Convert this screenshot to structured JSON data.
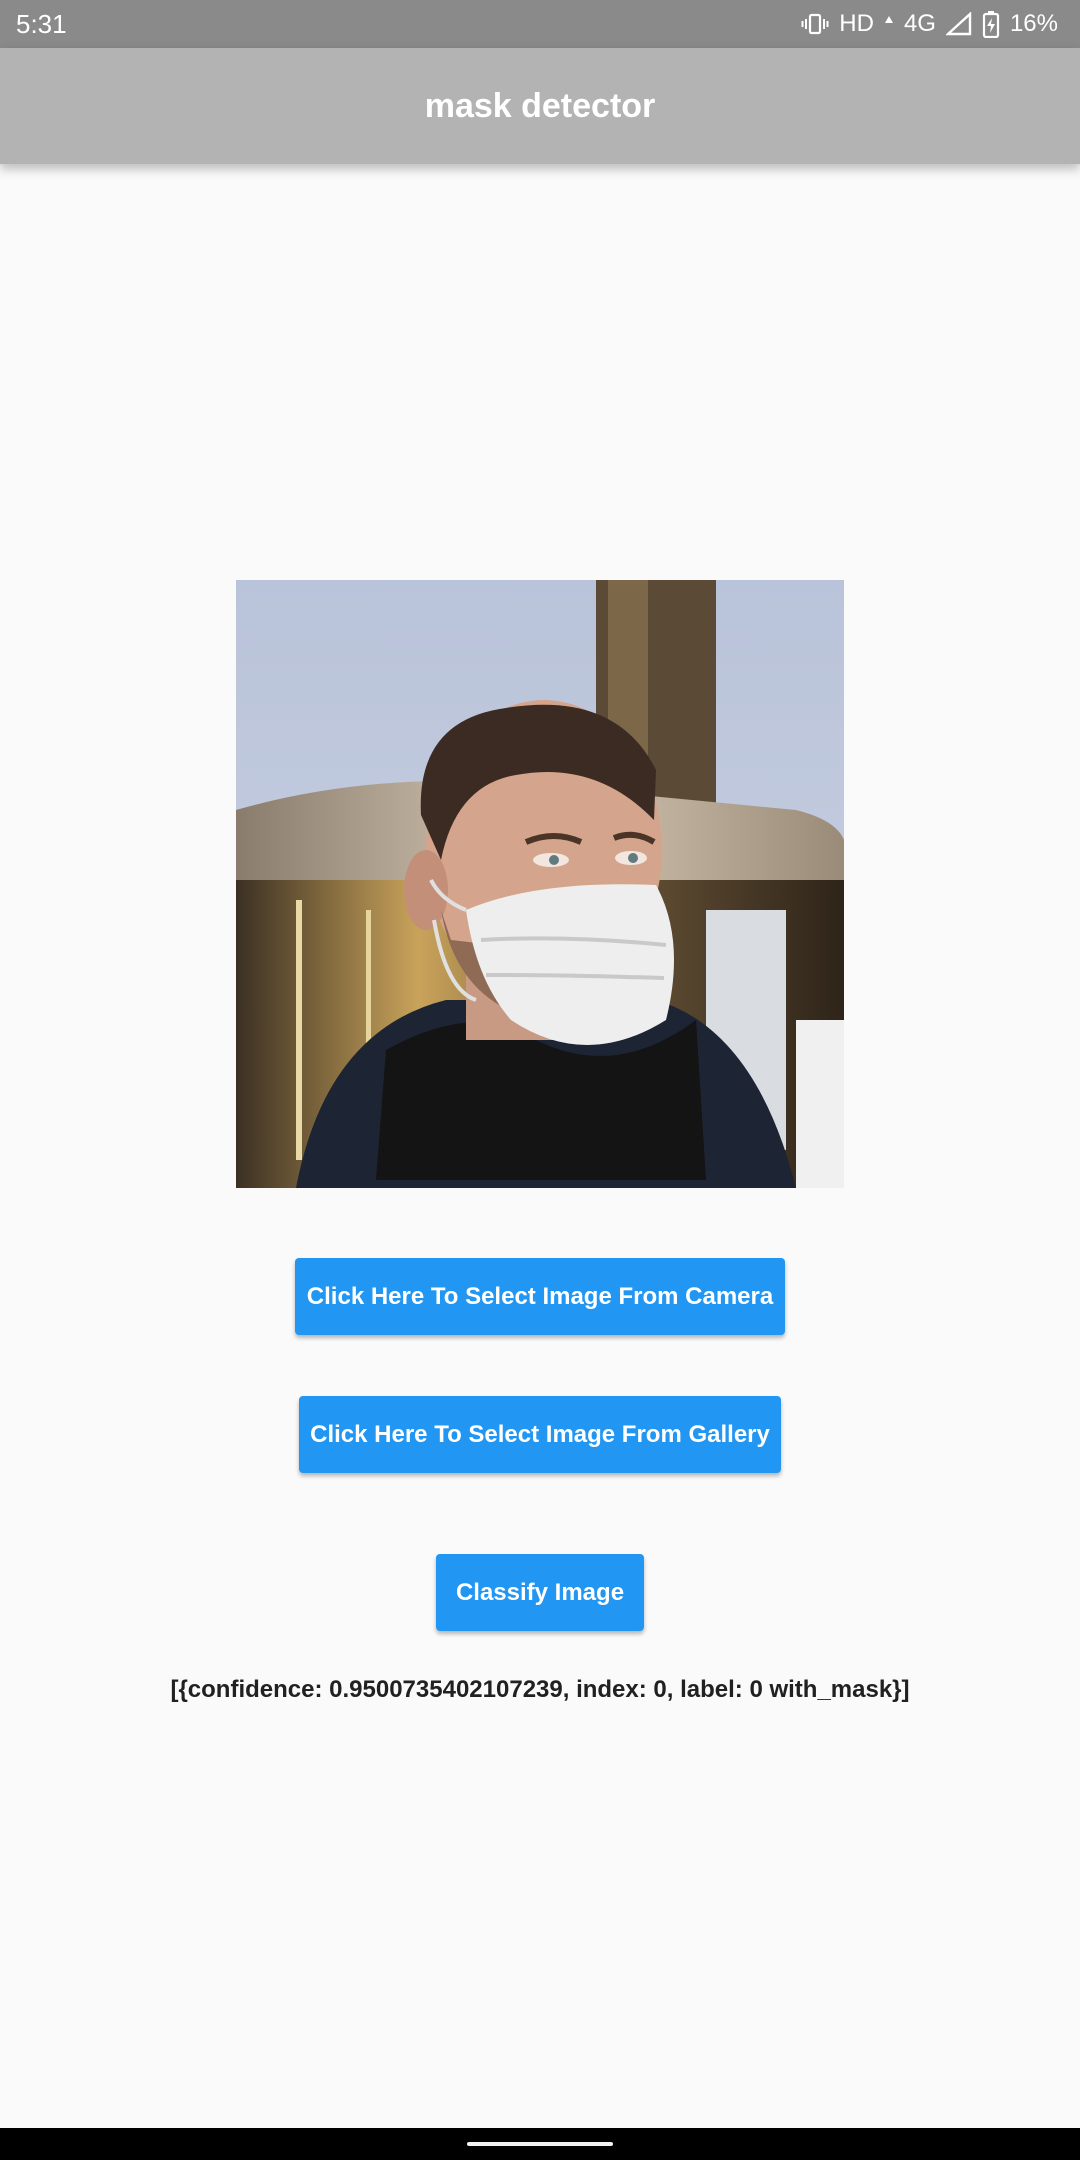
{
  "status_bar": {
    "time": "5:31",
    "network_hd": "HD",
    "network_type": "4G",
    "battery": "16%",
    "icons": [
      "vibrate-icon",
      "signal-icon",
      "battery-charging-icon"
    ]
  },
  "app_bar": {
    "title": "mask detector",
    "background": "#b3b3b3"
  },
  "main": {
    "image": {
      "icon": "photo-man-with-mask"
    },
    "camera_button": "Click Here To Select Image From Camera",
    "gallery_button": "Click Here To Select Image From Gallery",
    "classify_button": "Classify Image",
    "result_text": "[{confidence: 0.9500735402107239, index: 0, label: 0 with_mask}]",
    "accent": "#2196f3"
  }
}
